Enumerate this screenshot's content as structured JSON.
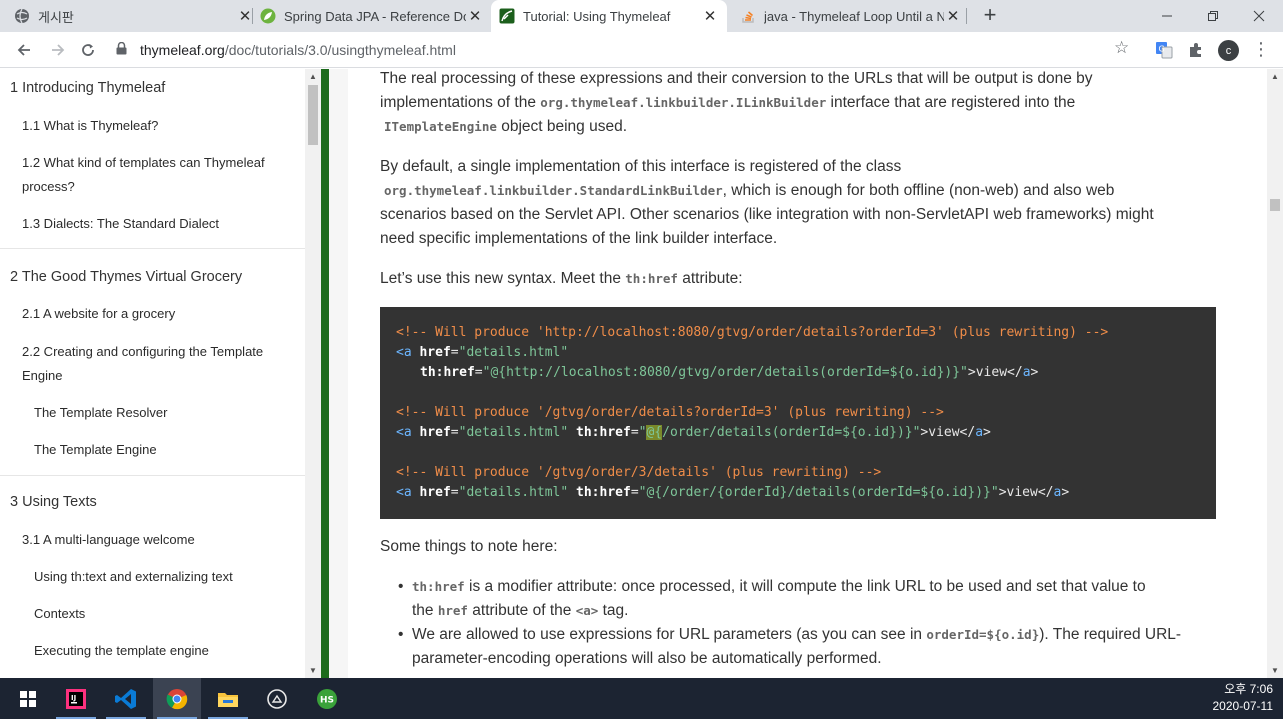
{
  "colors": {
    "accent_green": "#1c6b1c",
    "code_bg": "#333333",
    "taskbar": "#1c2432"
  },
  "tabs": [
    {
      "title": "게시판",
      "icon": "globe-icon"
    },
    {
      "title": "Spring Data JPA - Reference Do",
      "icon": "spring-leaf-icon"
    },
    {
      "title": "Tutorial: Using Thymeleaf",
      "icon": "thymeleaf-icon",
      "active": true
    },
    {
      "title": "java - Thymeleaf Loop Until a N",
      "icon": "stackoverflow-icon"
    }
  ],
  "address": {
    "host": "thymeleaf.org",
    "path": "/doc/tutorials/3.0/usingthymeleaf.html"
  },
  "profile": {
    "initial": "c"
  },
  "toc": {
    "s1": "1 Introducing Thymeleaf",
    "s1_1": "1.1 What is Thymeleaf?",
    "s1_2a": "1.2 What kind of templates can Thymeleaf",
    "s1_2b": "process?",
    "s1_3": "1.3 Dialects: The Standard Dialect",
    "s2": "2 The Good Thymes Virtual Grocery",
    "s2_1": "2.1 A website for a grocery",
    "s2_2a": "2.2 Creating and configuring the Template",
    "s2_2b": "Engine",
    "s2_2_1": "The Template Resolver",
    "s2_2_2": "The Template Engine",
    "s3": "3 Using Texts",
    "s3_1": "3.1 A multi-language welcome",
    "s3_1_1": "Using th:text and externalizing text",
    "s3_1_2": "Contexts",
    "s3_1_3": "Executing the template engine"
  },
  "content": {
    "p1_l1": "The real processing of these expressions and their conversion to the URLs that will be output is done by",
    "p1_l2a": "implementations of the ",
    "p1_l2_code": "org.thymeleaf.linkbuilder.ILinkBuilder",
    "p1_l2b": " interface that are registered into the",
    "p1_l3_code": "ITemplateEngine",
    "p1_l3b": " object being used.",
    "p2_l1": "By default, a single implementation of this interface is registered of the class",
    "p2_l2_code": "org.thymeleaf.linkbuilder.StandardLinkBuilder",
    "p2_l2b": ", which is enough for both offline (non-web) and also web",
    "p2_l3": "scenarios based on the Servlet API. Other scenarios (like integration with non-ServletAPI web frameworks) might",
    "p2_l4": "need specific implementations of the link builder interface.",
    "p3a": "Let’s use this new syntax. Meet the ",
    "p3_code": "th:href",
    "p3b": " attribute:",
    "code": {
      "c1": "<!-- Will produce 'http://localhost:8080/gtvg/order/details?orderId=3' (plus rewriting) -->",
      "c4": "<!-- Will produce '/gtvg/order/details?orderId=3' (plus rewriting) -->",
      "c6": "<!-- Will produce '/gtvg/order/3/details' (plus rewriting) -->",
      "tag_a": "<a",
      "href_attr": "href",
      "thhref_attr": "th:href",
      "details_val": "\"details.html\"",
      "url1": "\"@{http://localhost:8080/gtvg/order/details(orderId=${o.id})}\"",
      "url2_hl": "@{",
      "url2_rest": "/order/details(orderId=${o.id})}\"",
      "url3": "\"@{/order/{orderId}/details(orderId=${o.id})}\"",
      "view": ">view</",
      "close_a": "a",
      "gt": ">",
      "eq": "=",
      "quote": "\""
    },
    "p4": "Some things to note here:",
    "b1_code": "th:href",
    "b1a": " is a modifier attribute: once processed, it will compute the link URL to be used and set that value to",
    "b1b": "the ",
    "b1_code2": "href",
    "b1c": " attribute of the ",
    "b1_code3": "<a>",
    "b1d": " tag.",
    "b2a": "We are allowed to use expressions for URL parameters (as you can see in ",
    "b2_code": "orderId=${o.id}",
    "b2b": "). The required URL-",
    "b2c": "parameter-encoding operations will also be automatically performed."
  },
  "taskbar": {
    "items": [
      "windows-start-icon",
      "intellij-icon",
      "vscode-icon",
      "chrome-icon",
      "file-explorer-icon",
      "github-desktop-icon",
      "hs-app-icon"
    ],
    "time": "오후 7:06",
    "date": "2020-07-11"
  }
}
